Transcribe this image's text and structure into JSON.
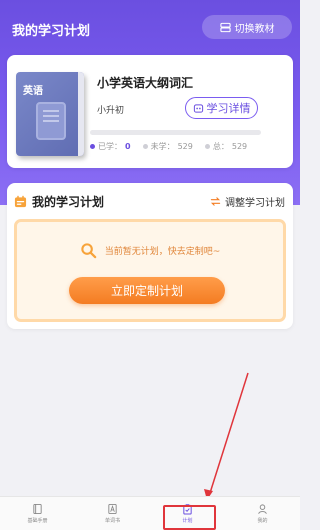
{
  "header": {
    "title": "我的学习计划",
    "switch_label": "切换教材"
  },
  "book": {
    "cover_title": "英语",
    "name": "小学英语大纲词汇",
    "grade": "小升初",
    "detail_label": "学习详情",
    "progress_fraction": 0.0,
    "stats": {
      "learned_label": "已学：",
      "learned_value": "0",
      "unlearned_label": "未学：",
      "unlearned_value": "529",
      "total_label": "总：",
      "total_value": "529"
    }
  },
  "plan": {
    "title": "我的学习计划",
    "adjust_label": "调整学习计划",
    "empty_message": "当前暂无计划，快去定制吧~",
    "make_plan_label": "立即定制计划"
  },
  "tabbar": {
    "tabs": [
      {
        "label": "基础手册",
        "icon": "book-icon",
        "active": false
      },
      {
        "label": "单词书",
        "icon": "letter-a-icon",
        "active": false
      },
      {
        "label": "计划",
        "icon": "clipboard-icon",
        "active": true
      },
      {
        "label": "我的",
        "icon": "person-icon",
        "active": false
      }
    ]
  },
  "colors": {
    "primary": "#6b4fe0",
    "accent_orange": "#f47c22",
    "highlight_red": "#e0353b"
  }
}
